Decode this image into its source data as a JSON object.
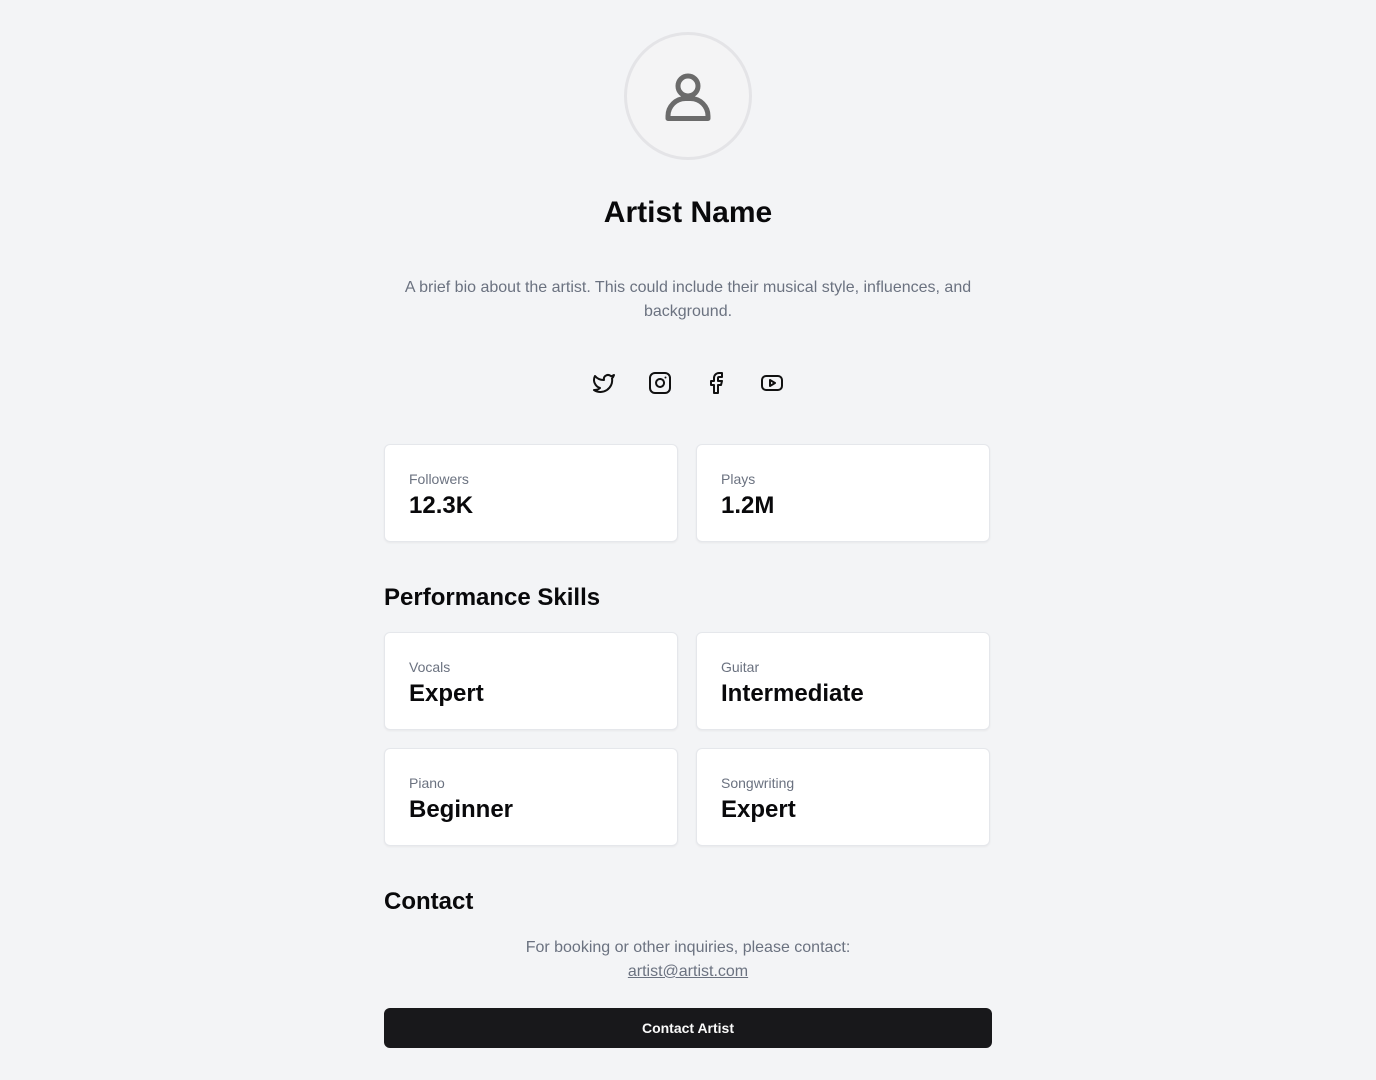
{
  "profile": {
    "name": "Artist Name",
    "bio": "A brief bio about the artist. This could include their musical style, influences, and background."
  },
  "socials": [
    {
      "icon": "twitter-icon"
    },
    {
      "icon": "instagram-icon"
    },
    {
      "icon": "facebook-icon"
    },
    {
      "icon": "youtube-icon"
    }
  ],
  "stats": [
    {
      "label": "Followers",
      "value": "12.3K"
    },
    {
      "label": "Plays",
      "value": "1.2M"
    }
  ],
  "skills": {
    "title": "Performance Skills",
    "items": [
      {
        "label": "Vocals",
        "value": "Expert"
      },
      {
        "label": "Guitar",
        "value": "Intermediate"
      },
      {
        "label": "Piano",
        "value": "Beginner"
      },
      {
        "label": "Songwriting",
        "value": "Expert"
      }
    ]
  },
  "contact": {
    "title": "Contact",
    "text": "For booking or other inquiries, please contact:",
    "email": "artist@artist.com",
    "button_label": "Contact Artist"
  },
  "colors": {
    "background": "#f3f4f6",
    "button": "#18181b",
    "muted_text": "#6b7280"
  }
}
